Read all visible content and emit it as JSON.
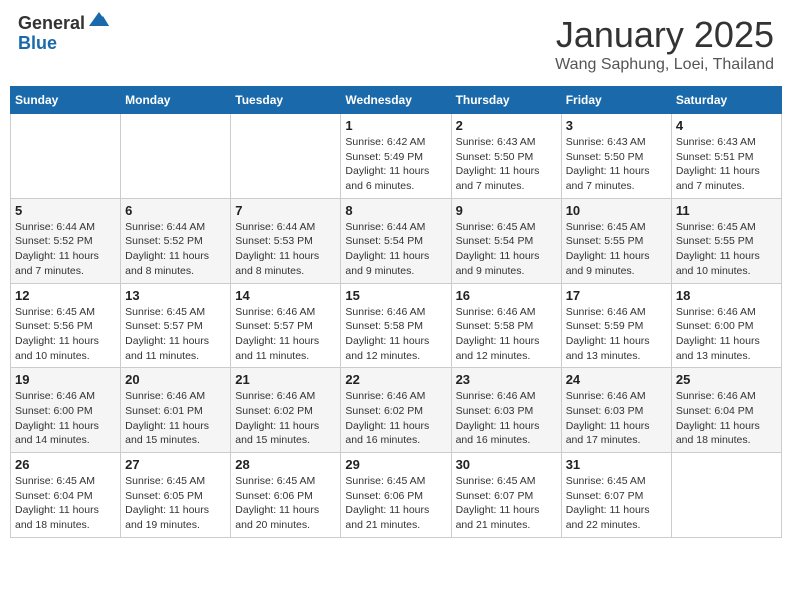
{
  "header": {
    "logo_general": "General",
    "logo_blue": "Blue",
    "month": "January 2025",
    "location": "Wang Saphung, Loei, Thailand"
  },
  "weekdays": [
    "Sunday",
    "Monday",
    "Tuesday",
    "Wednesday",
    "Thursday",
    "Friday",
    "Saturday"
  ],
  "weeks": [
    [
      {
        "day": "",
        "sunrise": "",
        "sunset": "",
        "daylight": ""
      },
      {
        "day": "",
        "sunrise": "",
        "sunset": "",
        "daylight": ""
      },
      {
        "day": "",
        "sunrise": "",
        "sunset": "",
        "daylight": ""
      },
      {
        "day": "1",
        "sunrise": "Sunrise: 6:42 AM",
        "sunset": "Sunset: 5:49 PM",
        "daylight": "Daylight: 11 hours and 6 minutes."
      },
      {
        "day": "2",
        "sunrise": "Sunrise: 6:43 AM",
        "sunset": "Sunset: 5:50 PM",
        "daylight": "Daylight: 11 hours and 7 minutes."
      },
      {
        "day": "3",
        "sunrise": "Sunrise: 6:43 AM",
        "sunset": "Sunset: 5:50 PM",
        "daylight": "Daylight: 11 hours and 7 minutes."
      },
      {
        "day": "4",
        "sunrise": "Sunrise: 6:43 AM",
        "sunset": "Sunset: 5:51 PM",
        "daylight": "Daylight: 11 hours and 7 minutes."
      }
    ],
    [
      {
        "day": "5",
        "sunrise": "Sunrise: 6:44 AM",
        "sunset": "Sunset: 5:52 PM",
        "daylight": "Daylight: 11 hours and 7 minutes."
      },
      {
        "day": "6",
        "sunrise": "Sunrise: 6:44 AM",
        "sunset": "Sunset: 5:52 PM",
        "daylight": "Daylight: 11 hours and 8 minutes."
      },
      {
        "day": "7",
        "sunrise": "Sunrise: 6:44 AM",
        "sunset": "Sunset: 5:53 PM",
        "daylight": "Daylight: 11 hours and 8 minutes."
      },
      {
        "day": "8",
        "sunrise": "Sunrise: 6:44 AM",
        "sunset": "Sunset: 5:54 PM",
        "daylight": "Daylight: 11 hours and 9 minutes."
      },
      {
        "day": "9",
        "sunrise": "Sunrise: 6:45 AM",
        "sunset": "Sunset: 5:54 PM",
        "daylight": "Daylight: 11 hours and 9 minutes."
      },
      {
        "day": "10",
        "sunrise": "Sunrise: 6:45 AM",
        "sunset": "Sunset: 5:55 PM",
        "daylight": "Daylight: 11 hours and 9 minutes."
      },
      {
        "day": "11",
        "sunrise": "Sunrise: 6:45 AM",
        "sunset": "Sunset: 5:55 PM",
        "daylight": "Daylight: 11 hours and 10 minutes."
      }
    ],
    [
      {
        "day": "12",
        "sunrise": "Sunrise: 6:45 AM",
        "sunset": "Sunset: 5:56 PM",
        "daylight": "Daylight: 11 hours and 10 minutes."
      },
      {
        "day": "13",
        "sunrise": "Sunrise: 6:45 AM",
        "sunset": "Sunset: 5:57 PM",
        "daylight": "Daylight: 11 hours and 11 minutes."
      },
      {
        "day": "14",
        "sunrise": "Sunrise: 6:46 AM",
        "sunset": "Sunset: 5:57 PM",
        "daylight": "Daylight: 11 hours and 11 minutes."
      },
      {
        "day": "15",
        "sunrise": "Sunrise: 6:46 AM",
        "sunset": "Sunset: 5:58 PM",
        "daylight": "Daylight: 11 hours and 12 minutes."
      },
      {
        "day": "16",
        "sunrise": "Sunrise: 6:46 AM",
        "sunset": "Sunset: 5:58 PM",
        "daylight": "Daylight: 11 hours and 12 minutes."
      },
      {
        "day": "17",
        "sunrise": "Sunrise: 6:46 AM",
        "sunset": "Sunset: 5:59 PM",
        "daylight": "Daylight: 11 hours and 13 minutes."
      },
      {
        "day": "18",
        "sunrise": "Sunrise: 6:46 AM",
        "sunset": "Sunset: 6:00 PM",
        "daylight": "Daylight: 11 hours and 13 minutes."
      }
    ],
    [
      {
        "day": "19",
        "sunrise": "Sunrise: 6:46 AM",
        "sunset": "Sunset: 6:00 PM",
        "daylight": "Daylight: 11 hours and 14 minutes."
      },
      {
        "day": "20",
        "sunrise": "Sunrise: 6:46 AM",
        "sunset": "Sunset: 6:01 PM",
        "daylight": "Daylight: 11 hours and 15 minutes."
      },
      {
        "day": "21",
        "sunrise": "Sunrise: 6:46 AM",
        "sunset": "Sunset: 6:02 PM",
        "daylight": "Daylight: 11 hours and 15 minutes."
      },
      {
        "day": "22",
        "sunrise": "Sunrise: 6:46 AM",
        "sunset": "Sunset: 6:02 PM",
        "daylight": "Daylight: 11 hours and 16 minutes."
      },
      {
        "day": "23",
        "sunrise": "Sunrise: 6:46 AM",
        "sunset": "Sunset: 6:03 PM",
        "daylight": "Daylight: 11 hours and 16 minutes."
      },
      {
        "day": "24",
        "sunrise": "Sunrise: 6:46 AM",
        "sunset": "Sunset: 6:03 PM",
        "daylight": "Daylight: 11 hours and 17 minutes."
      },
      {
        "day": "25",
        "sunrise": "Sunrise: 6:46 AM",
        "sunset": "Sunset: 6:04 PM",
        "daylight": "Daylight: 11 hours and 18 minutes."
      }
    ],
    [
      {
        "day": "26",
        "sunrise": "Sunrise: 6:45 AM",
        "sunset": "Sunset: 6:04 PM",
        "daylight": "Daylight: 11 hours and 18 minutes."
      },
      {
        "day": "27",
        "sunrise": "Sunrise: 6:45 AM",
        "sunset": "Sunset: 6:05 PM",
        "daylight": "Daylight: 11 hours and 19 minutes."
      },
      {
        "day": "28",
        "sunrise": "Sunrise: 6:45 AM",
        "sunset": "Sunset: 6:06 PM",
        "daylight": "Daylight: 11 hours and 20 minutes."
      },
      {
        "day": "29",
        "sunrise": "Sunrise: 6:45 AM",
        "sunset": "Sunset: 6:06 PM",
        "daylight": "Daylight: 11 hours and 21 minutes."
      },
      {
        "day": "30",
        "sunrise": "Sunrise: 6:45 AM",
        "sunset": "Sunset: 6:07 PM",
        "daylight": "Daylight: 11 hours and 21 minutes."
      },
      {
        "day": "31",
        "sunrise": "Sunrise: 6:45 AM",
        "sunset": "Sunset: 6:07 PM",
        "daylight": "Daylight: 11 hours and 22 minutes."
      },
      {
        "day": "",
        "sunrise": "",
        "sunset": "",
        "daylight": ""
      }
    ]
  ]
}
